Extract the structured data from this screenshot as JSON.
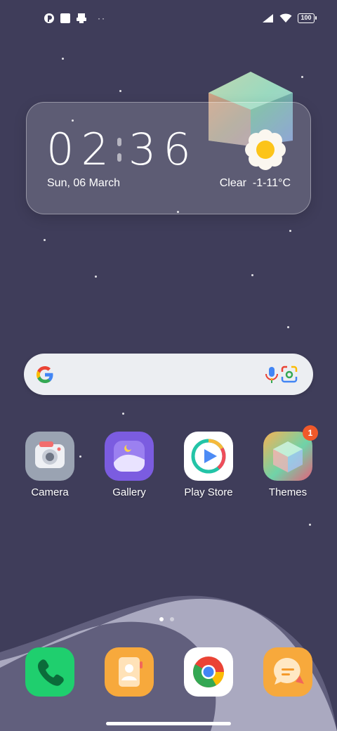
{
  "status_bar": {
    "left_icons": [
      "app-notification-icon",
      "square-notification-icon",
      "printer-notification-icon"
    ],
    "more_dots": "··",
    "right_icons": [
      "signal-icon",
      "wifi-icon"
    ],
    "battery": "100"
  },
  "widget": {
    "hour": "02",
    "minute": "36",
    "date": "Sun, 06 March",
    "condition": "Clear",
    "temperature": "-1-11°C",
    "weather_icon": "sun-icon"
  },
  "search": {
    "logo": "google-logo",
    "mic_icon": "microphone-icon",
    "lens_icon": "lens-icon"
  },
  "apps": [
    {
      "label": "Camera",
      "icon": "camera-icon",
      "color": "#9aa3b2"
    },
    {
      "label": "Gallery",
      "icon": "gallery-icon",
      "color": "#7b5ce0"
    },
    {
      "label": "Play Store",
      "icon": "play-store-icon",
      "color": "#ffffff"
    },
    {
      "label": "Themes",
      "icon": "themes-icon",
      "color": "#f0a040",
      "badge": "1"
    }
  ],
  "pager": {
    "pages": 2,
    "active": 1
  },
  "dock": [
    {
      "icon": "phone-icon",
      "color": "#1fcf6e"
    },
    {
      "icon": "contacts-icon",
      "color": "#f7a93c"
    },
    {
      "icon": "chrome-icon",
      "color": "#ffffff"
    },
    {
      "icon": "messages-icon",
      "color": "#f7a93c"
    }
  ]
}
